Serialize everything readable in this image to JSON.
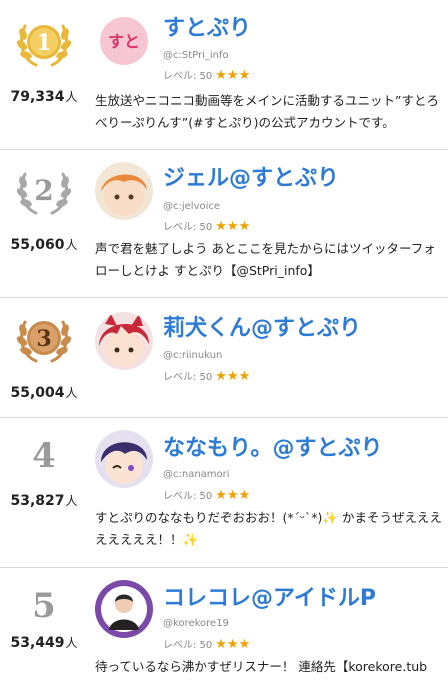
{
  "unit": "人",
  "level_label": "レベル: 50",
  "stars": "★★★",
  "entries": [
    {
      "rank": "1",
      "count": "79,334",
      "name": "すとぷり",
      "handle": "@c:StPri_info",
      "description": "生放送やニコニコ動画等をメインに活動するユニット”すとろべりーぷりんす”(#すとぷり)の公式アカウントです。",
      "medal": "gold-laurel-medal"
    },
    {
      "rank": "2",
      "count": "55,060",
      "name": "ジェル@すとぷり",
      "handle": "@c:jelvoice",
      "description": "声で君を魅了しよう あとここを見たからにはツイッターフォローしとけよ すとぷり【@StPri_info】",
      "medal": "silver-laurel-medal"
    },
    {
      "rank": "3",
      "count": "55,004",
      "name": "莉犬くん@すとぷり",
      "handle": "@c:riinukun",
      "description": "",
      "medal": "bronze-laurel-medal"
    },
    {
      "rank": "4",
      "count": "53,827",
      "name": "ななもり。@すとぷり",
      "handle": "@c:nanamori",
      "description": "すとぷりのななもりだぞおおお！(*ˊᵕˋ*)✨ かまそうぜええええええええ！！✨",
      "medal": ""
    },
    {
      "rank": "5",
      "count": "53,449",
      "name": "コレコレ@アイドルP",
      "handle": "@korekore19",
      "description": "待っているなら沸かすぜリスナー！ 連絡先【korekore.tub",
      "medal": ""
    }
  ],
  "colors": {
    "name": "#2e7bd6",
    "gold": "#e9b83a",
    "silver": "#a8a8a8",
    "bronze": "#c98b4c",
    "star": "#f0a000"
  }
}
